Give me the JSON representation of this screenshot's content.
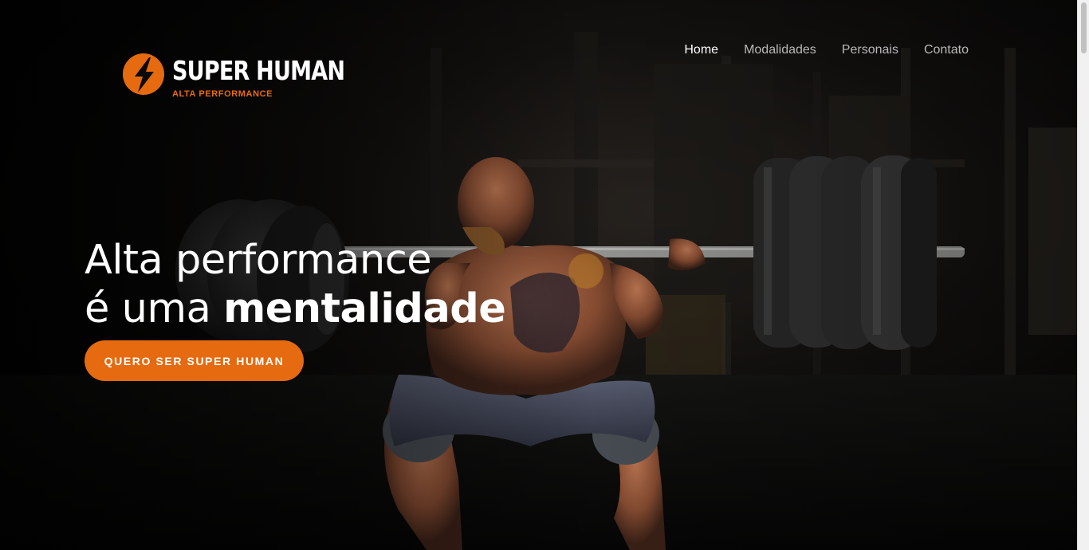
{
  "brand": {
    "name": "SUPER HUMAN",
    "tagline": "ALTA PERFORMANCE",
    "icon": "lightning-bolt-icon",
    "accent_color": "#e56a10"
  },
  "nav": {
    "items": [
      {
        "label": "Home",
        "active": true
      },
      {
        "label": "Modalidades",
        "active": false
      },
      {
        "label": "Personais",
        "active": false
      },
      {
        "label": "Contato",
        "active": false
      }
    ]
  },
  "hero": {
    "headline_line1": "Alta performance",
    "headline_line2_regular": "é uma ",
    "headline_line2_bold": "mentalidade",
    "cta_label": "QUERO SER SUPER HUMAN",
    "background": "weightlifter-squatting-with-barbell-photo"
  }
}
